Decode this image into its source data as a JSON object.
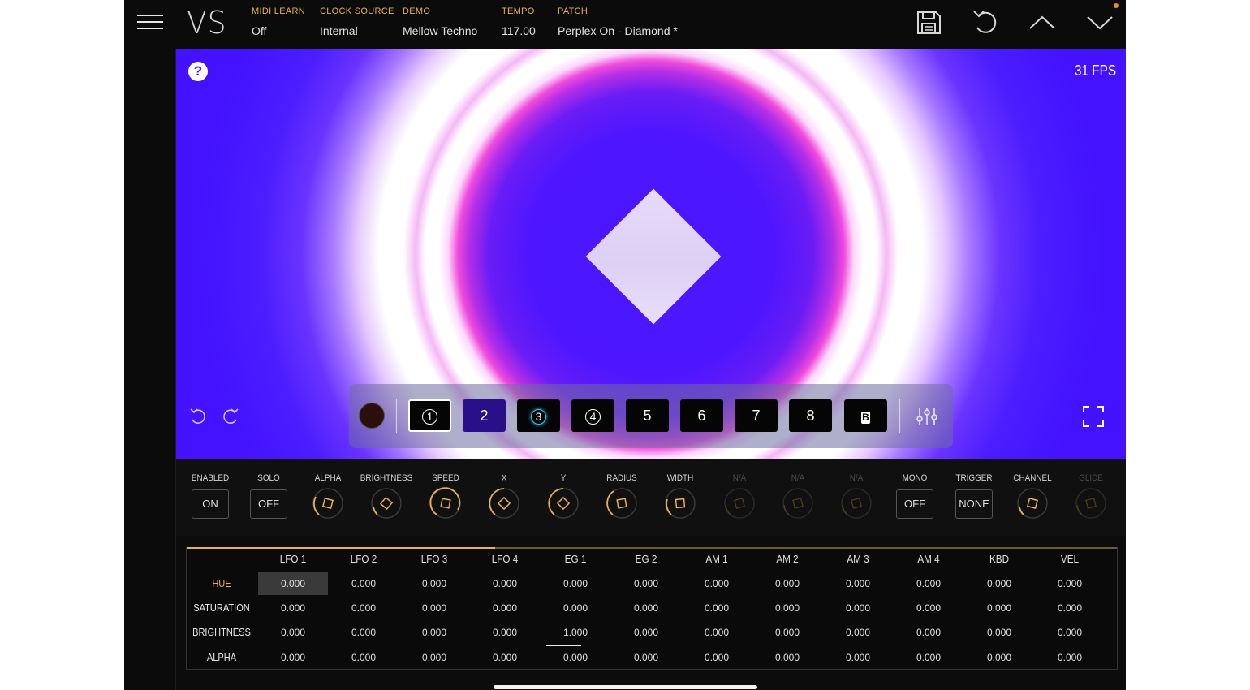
{
  "app": {
    "logo": "VS"
  },
  "header": {
    "midi_learn": {
      "label": "MIDI LEARN",
      "value": "Off"
    },
    "clock_source": {
      "label": "CLOCK SOURCE",
      "value": "Internal"
    },
    "demo": {
      "label": "DEMO",
      "value": "Mellow Techno"
    },
    "tempo": {
      "label": "TEMPO",
      "value": "117.00"
    },
    "patch": {
      "label": "PATCH",
      "value": "Perplex On - Diamond *"
    },
    "icons": [
      "save-icon",
      "undo-icon",
      "chevron-up-icon",
      "chevron-down-icon"
    ]
  },
  "canvas": {
    "help": "?",
    "fps": "31 FPS"
  },
  "layers": {
    "buttons": [
      "1",
      "2",
      "3",
      "4",
      "5",
      "6",
      "7",
      "8",
      "B"
    ],
    "selected": "1",
    "active": "2"
  },
  "controls": {
    "enabled": {
      "label": "ENABLED",
      "value": "ON"
    },
    "solo": {
      "label": "SOLO",
      "value": "OFF"
    },
    "alpha": {
      "label": "ALPHA"
    },
    "brightness": {
      "label": "BRIGHTNESS"
    },
    "speed": {
      "label": "SPEED"
    },
    "x": {
      "label": "X"
    },
    "y": {
      "label": "Y"
    },
    "radius": {
      "label": "RADIUS"
    },
    "width": {
      "label": "WIDTH"
    },
    "na1": {
      "label": "N/A"
    },
    "na2": {
      "label": "N/A"
    },
    "na3": {
      "label": "N/A"
    },
    "mono": {
      "label": "MONO",
      "value": "OFF"
    },
    "trigger": {
      "label": "TRIGGER",
      "value": "NONE"
    },
    "channel": {
      "label": "CHANNEL"
    },
    "glide": {
      "label": "GLIDE"
    }
  },
  "matrix": {
    "columns": [
      "LFO 1",
      "LFO 2",
      "LFO 3",
      "LFO 4",
      "EG 1",
      "EG 2",
      "AM 1",
      "AM 2",
      "AM 3",
      "AM 4",
      "KBD",
      "VEL"
    ],
    "rows": [
      {
        "label": "HUE",
        "values": [
          "0.000",
          "0.000",
          "0.000",
          "0.000",
          "0.000",
          "0.000",
          "0.000",
          "0.000",
          "0.000",
          "0.000",
          "0.000",
          "0.000"
        ]
      },
      {
        "label": "SATURATION",
        "values": [
          "0.000",
          "0.000",
          "0.000",
          "0.000",
          "0.000",
          "0.000",
          "0.000",
          "0.000",
          "0.000",
          "0.000",
          "0.000",
          "0.000"
        ]
      },
      {
        "label": "BRIGHTNESS",
        "values": [
          "0.000",
          "0.000",
          "0.000",
          "0.000",
          "1.000",
          "0.000",
          "0.000",
          "0.000",
          "0.000",
          "0.000",
          "0.000",
          "0.000"
        ]
      },
      {
        "label": "ALPHA",
        "values": [
          "0.000",
          "0.000",
          "0.000",
          "0.000",
          "0.000",
          "0.000",
          "0.000",
          "0.000",
          "0.000",
          "0.000",
          "0.000",
          "0.000"
        ]
      }
    ],
    "selected_row": "HUE",
    "selected_cell": "HUE / LFO 1"
  },
  "colors": {
    "accent": "#e8b24c",
    "canvas_bg": "#4a16ff",
    "layer_active": "#28108a"
  }
}
